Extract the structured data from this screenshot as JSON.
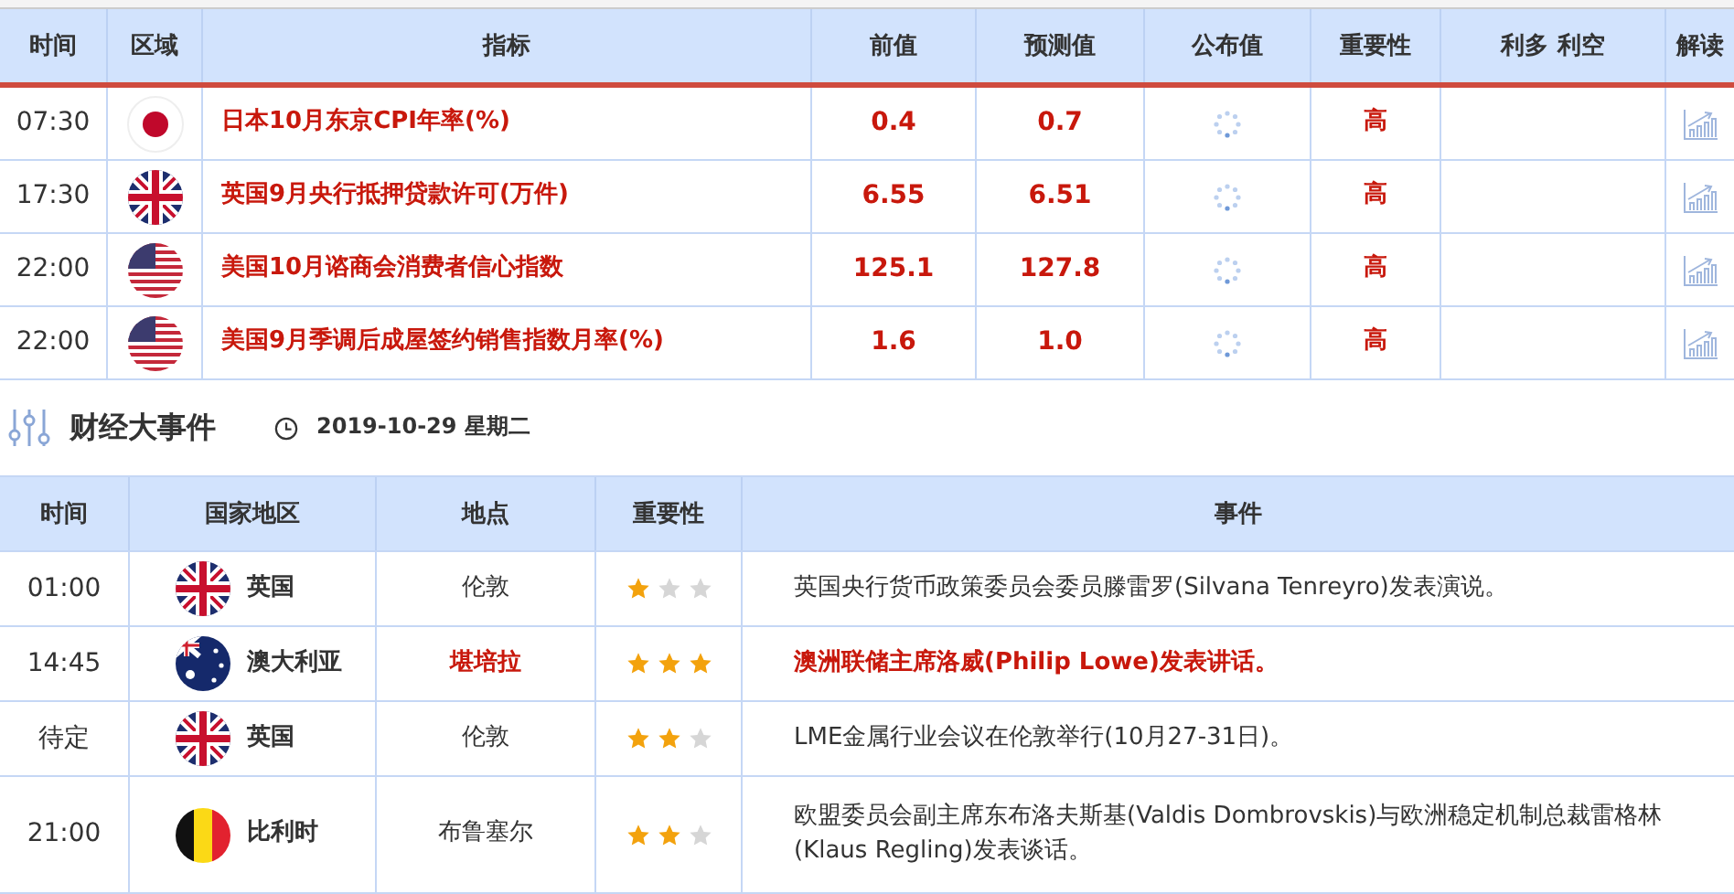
{
  "indicators": {
    "columns": [
      "时间",
      "区域",
      "指标",
      "前值",
      "预测值",
      "公布值",
      "重要性",
      "利多 利空",
      "解读"
    ],
    "rows": [
      {
        "time": "07:30",
        "kind": "jp",
        "name": "日本10月东京CPI年率(%)",
        "previous": "0.4",
        "forecast": "0.7",
        "importance": "高"
      },
      {
        "time": "17:30",
        "kind": "gb",
        "name": "英国9月央行抵押贷款许可(万件)",
        "previous": "6.55",
        "forecast": "6.51",
        "importance": "高"
      },
      {
        "time": "22:00",
        "kind": "us",
        "name": "美国10月谘商会消费者信心指数",
        "previous": "125.1",
        "forecast": "127.8",
        "importance": "高"
      },
      {
        "time": "22:00",
        "kind": "us",
        "name": "美国9月季调后成屋签约销售指数月率(%)",
        "previous": "1.6",
        "forecast": "1.0",
        "importance": "高"
      }
    ]
  },
  "events": {
    "title": "财经大事件",
    "date": "2019-10-29 星期二",
    "columns": [
      "时间",
      "国家地区",
      "地点",
      "重要性",
      "事件"
    ],
    "rows": [
      {
        "time": "01:00",
        "kind": "gb",
        "country": "英国",
        "place": "伦敦",
        "stars": 1,
        "highlight": false,
        "event": "英国央行货币政策委员会委员滕雷罗(Silvana Tenreyro)发表演说。"
      },
      {
        "time": "14:45",
        "kind": "au",
        "country": "澳大利亚",
        "place": "堪培拉",
        "stars": 3,
        "highlight": true,
        "event": "澳洲联储主席洛威(Philip Lowe)发表讲话。"
      },
      {
        "time": "待定",
        "kind": "gb",
        "country": "英国",
        "place": "伦敦",
        "stars": 2,
        "highlight": false,
        "event": "LME金属行业会议在伦敦举行(10月27-31日)。"
      },
      {
        "time": "21:00",
        "kind": "be",
        "country": "比利时",
        "place": "布鲁塞尔",
        "stars": 2,
        "highlight": false,
        "event": "欧盟委员会副主席东布洛夫斯基(Valdis Dombrovskis)与欧洲稳定机制总裁雷格林(Klaus Regling)发表谈话。"
      }
    ]
  }
}
